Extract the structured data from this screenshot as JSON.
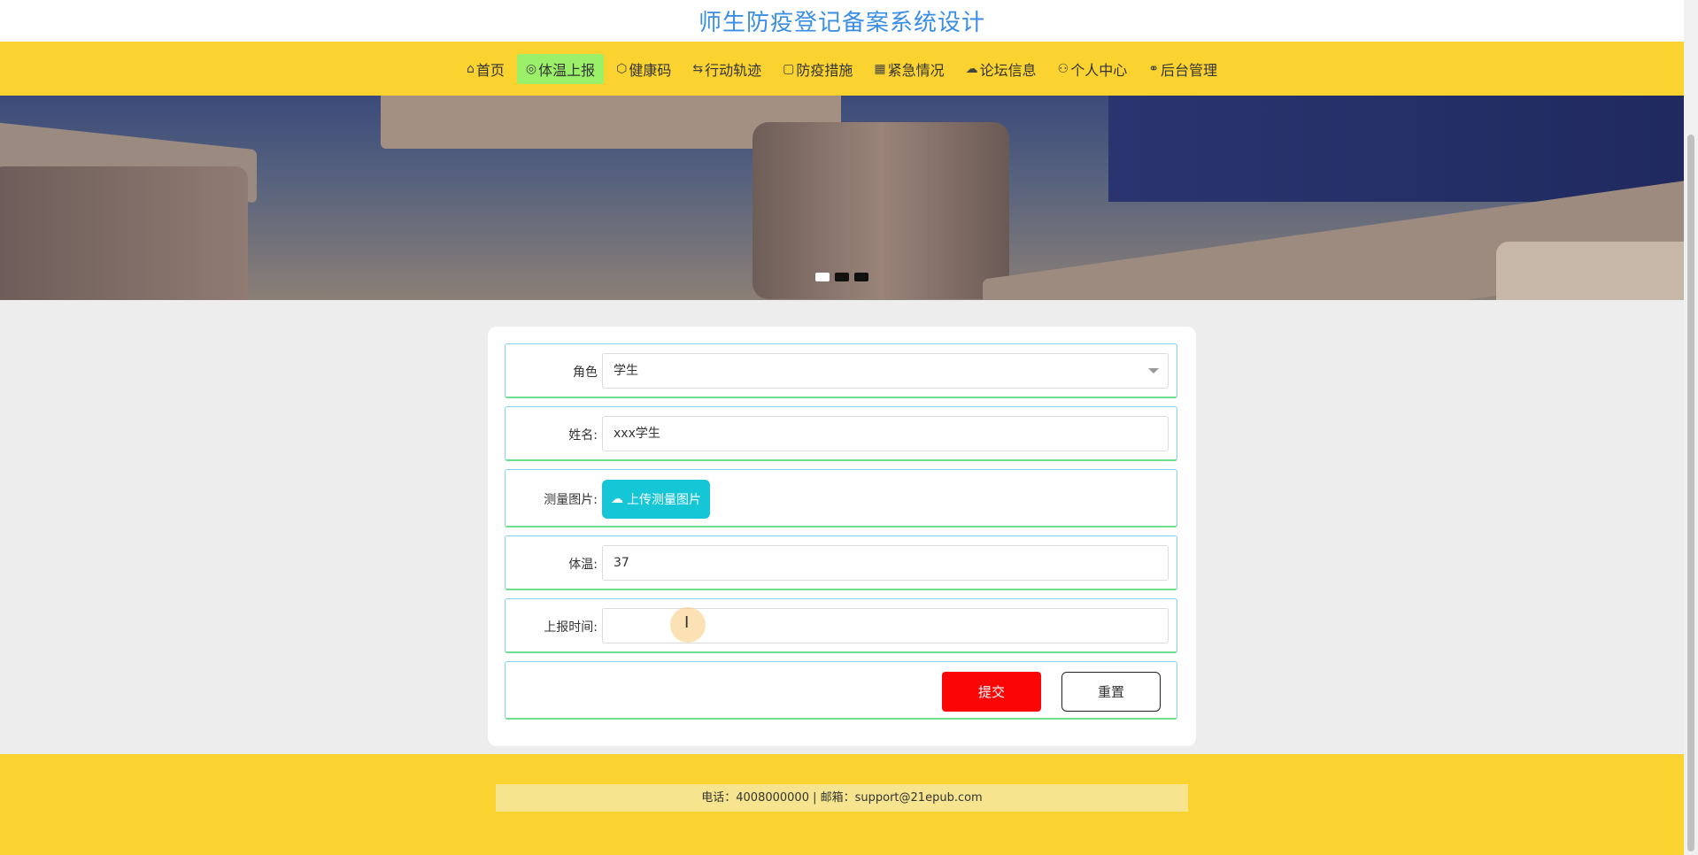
{
  "header": {
    "title": "师生防疫登记备案系统设计"
  },
  "nav": {
    "items": [
      {
        "icon": "home-icon",
        "glyph": "⌂",
        "label": "首页",
        "active": false
      },
      {
        "icon": "temperature-icon",
        "glyph": "◎",
        "label": "体温上报",
        "active": true
      },
      {
        "icon": "health-code-icon",
        "glyph": "⬡",
        "label": "健康码",
        "active": false
      },
      {
        "icon": "track-icon",
        "glyph": "⇆",
        "label": "行动轨迹",
        "active": false
      },
      {
        "icon": "measures-icon",
        "glyph": "▢",
        "label": "防疫措施",
        "active": false
      },
      {
        "icon": "emergency-icon",
        "glyph": "▦",
        "label": "紧急情况",
        "active": false
      },
      {
        "icon": "forum-icon",
        "glyph": "☁",
        "label": "论坛信息",
        "active": false
      },
      {
        "icon": "user-icon",
        "glyph": "⚇",
        "label": "个人中心",
        "active": false
      },
      {
        "icon": "link-icon",
        "glyph": "⚭",
        "label": "后台管理",
        "active": false
      }
    ],
    "active_color": "#9bf06a",
    "bar_color": "#fbd331"
  },
  "banner": {
    "slide_count": 3,
    "active_slide": 1
  },
  "form": {
    "role": {
      "label": "角色",
      "value": "学生"
    },
    "name": {
      "label": "姓名:",
      "value": "xxx学生"
    },
    "photo": {
      "label": "测量图片:",
      "button": "上传测量图片"
    },
    "temperature": {
      "label": "体温:",
      "value": "37"
    },
    "report_time": {
      "label": "上报时间:",
      "value": ""
    },
    "submit": "提交",
    "reset": "重置"
  },
  "footer": {
    "contact": "电话：4008000000 | 邮箱：support@21epub.com"
  }
}
